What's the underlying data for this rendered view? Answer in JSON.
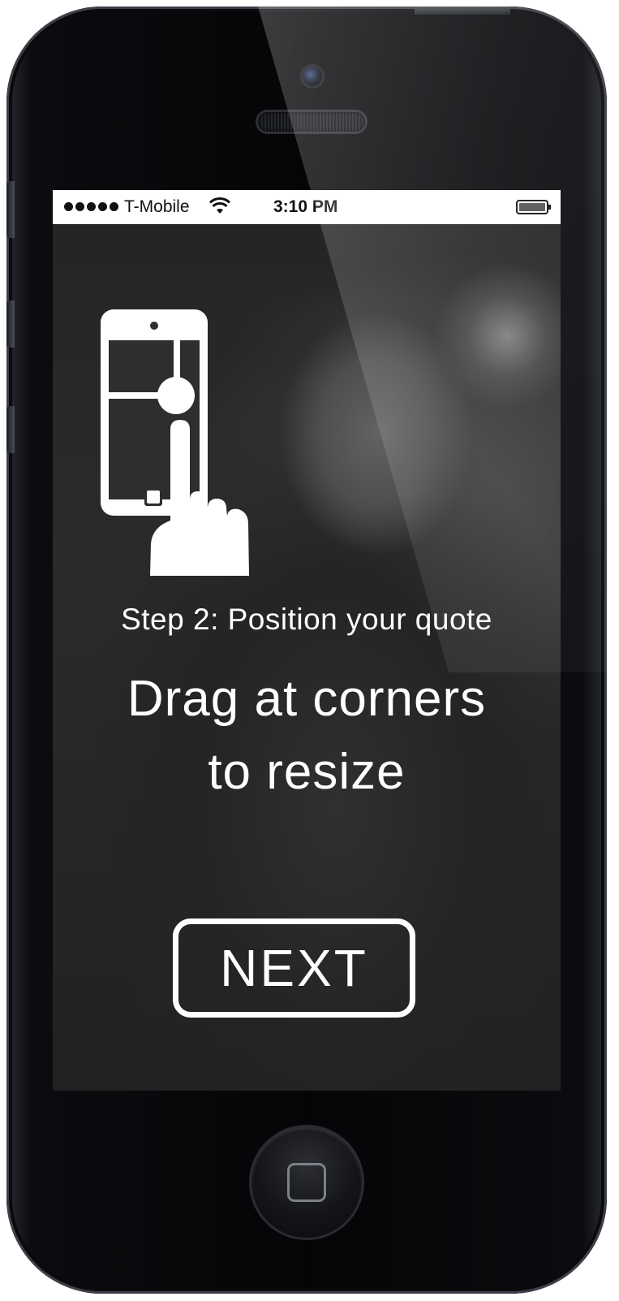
{
  "status_bar": {
    "carrier": "T-Mobile",
    "time": "3:10 PM",
    "signal_bars": 5,
    "icons": [
      "signal-dots-icon",
      "wifi-icon",
      "battery-icon"
    ]
  },
  "tutorial": {
    "illustration": "phone-with-finger-drag-icon",
    "step_label": "Step 2: Position your quote",
    "instruction_line1": "Drag at corners",
    "instruction_line2": "to resize",
    "next_label": "NEXT"
  },
  "colors": {
    "text": "#ffffff",
    "overlay": "#1c1c1c",
    "device": "#050507"
  }
}
